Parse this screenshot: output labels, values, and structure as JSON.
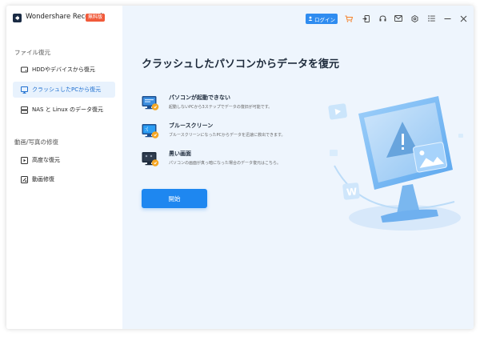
{
  "app": {
    "name": "Wondershare Recoverit",
    "edition_badge": "無料版",
    "login_label": "ログイン"
  },
  "toolbar_icons": [
    "cart-icon",
    "import-icon",
    "headset-icon",
    "mail-icon",
    "settings-icon",
    "menu-icon",
    "minimize-icon",
    "close-icon"
  ],
  "sidebar": {
    "sections": [
      {
        "label": "ファイル復元",
        "items": [
          {
            "label": "HDDやデバイスから復元",
            "icon": "hdd-icon",
            "active": false
          },
          {
            "label": "クラッシュしたPCから復元",
            "icon": "monitor-icon",
            "active": true
          },
          {
            "label": "NAS と Linux のデータ復元",
            "icon": "nas-icon",
            "active": false
          }
        ]
      },
      {
        "label": "動画/写真の修復",
        "items": [
          {
            "label": "高度な復元",
            "icon": "video-icon",
            "active": false
          },
          {
            "label": "動画修復",
            "icon": "video-repair-icon",
            "active": false
          }
        ]
      }
    ]
  },
  "main": {
    "title": "クラッシュしたパソコンからデータを復元",
    "features": [
      {
        "title": "パソコンが起動できない",
        "description": "起動しないPCから3ステップでデータの復旧が可能です。",
        "icon": "pc-no-boot-icon"
      },
      {
        "title": "ブルースクリーン",
        "description": "ブルースクリーンになったPCからデータを迅速に救出できます。",
        "icon": "blue-screen-icon"
      },
      {
        "title": "黒い画面",
        "description": "パソコンの画面が真っ暗になった場合のデータ復元はこちら。",
        "icon": "black-screen-icon"
      }
    ],
    "start_label": "開始"
  },
  "colors": {
    "accent": "#1e87f0",
    "badge": "#f15a3a",
    "sidebar_active_bg": "#e8f2fd",
    "main_bg": "#eef5fd"
  }
}
